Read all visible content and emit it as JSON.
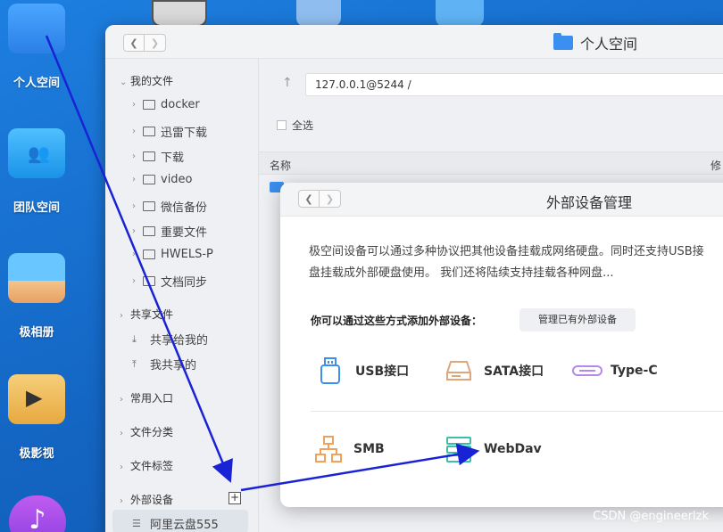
{
  "desktop": {
    "icons": [
      {
        "label": "个人空间"
      },
      {
        "label": "团队空间"
      },
      {
        "label": "极相册"
      },
      {
        "label": "极影视"
      }
    ]
  },
  "window": {
    "title": "个人空间",
    "address": "127.0.0.1@5244 /",
    "select_all": "全选",
    "col_name": "名称",
    "col_modified": "修"
  },
  "sidebar": {
    "my_files": "我的文件",
    "folders": [
      "docker",
      "迅雷下载",
      "下载",
      "video",
      "微信备份",
      "重要文件",
      "HWELS-P",
      "文档同步"
    ],
    "shared": "共享文件",
    "shared_items": [
      "共享给我的",
      "我共享的"
    ],
    "common": "常用入口",
    "category": "文件分类",
    "tags": "文件标签",
    "external": "外部设备",
    "external_items": [
      "阿里云盘555"
    ]
  },
  "dialog": {
    "title": "外部设备管理",
    "desc_line1": "极空间设备可以通过多种协议把其他设备挂载成网络硬盘。同时还支持USB接",
    "desc_line2": "盘挂载成外部硬盘使用。 我们还将陆续支持挂载各种网盘...",
    "subtitle": "你可以通过这些方式添加外部设备：",
    "manage_btn": "管理已有外部设备",
    "options": [
      {
        "label": "USB接口",
        "icon": "usb-icon"
      },
      {
        "label": "SATA接口",
        "icon": "sata-icon"
      },
      {
        "label": "Type-C",
        "icon": "typec-icon"
      },
      {
        "label": "SMB",
        "icon": "smb-icon"
      },
      {
        "label": "WebDav",
        "icon": "webdav-icon"
      }
    ]
  },
  "watermark": "CSDN @engineerlzk",
  "colors": {
    "desktop": "#1466c4",
    "arrow": "#1a22d6",
    "accent": "#3b8ff0"
  }
}
